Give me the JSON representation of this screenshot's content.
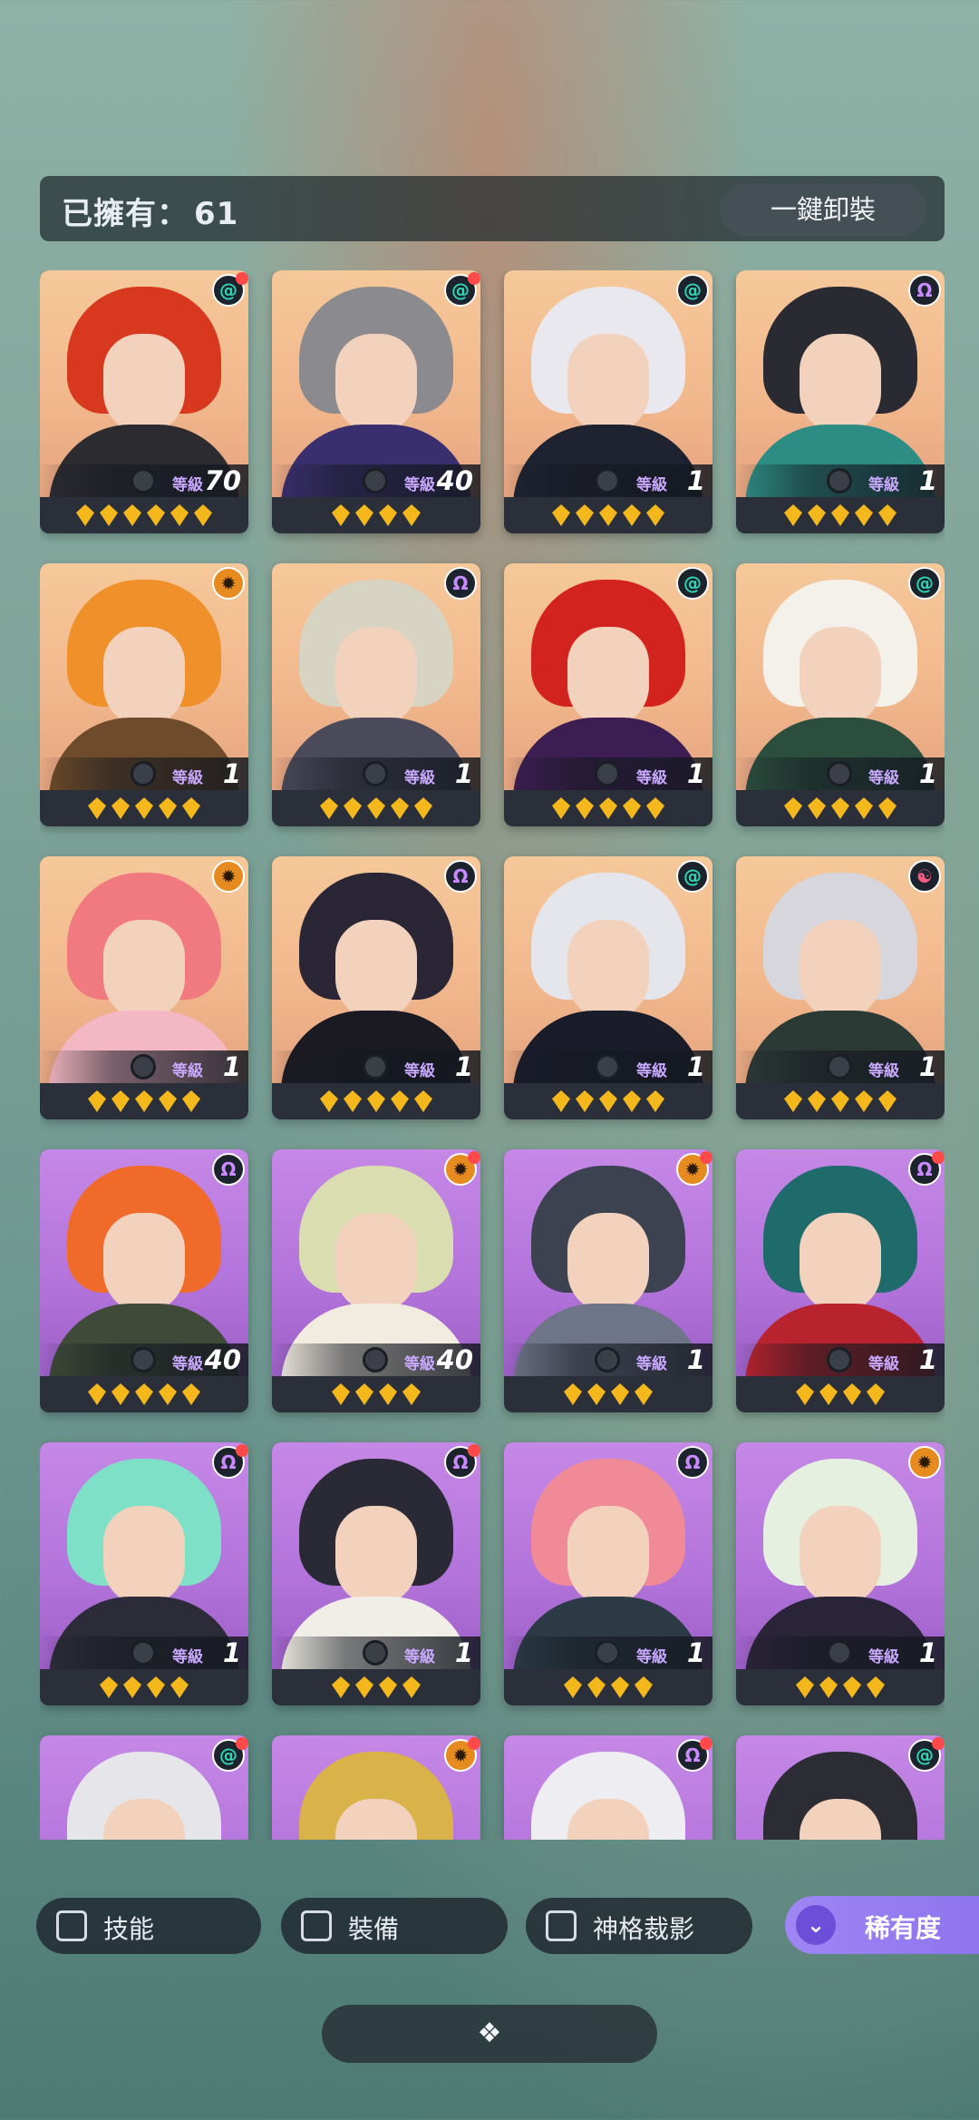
{
  "header": {
    "owned_label": "已擁有：",
    "owned_count": "61",
    "unequip_label": "一鍵卸裝"
  },
  "level_label": "等級",
  "cards": [
    {
      "element": "swirl",
      "dot": true,
      "level": "70",
      "stars": 6,
      "bg": "peach",
      "hair": "#d8381e",
      "body": "#2b2b30"
    },
    {
      "element": "swirl",
      "dot": true,
      "level": "40",
      "stars": 4,
      "bg": "peach",
      "hair": "#8a8a8f",
      "body": "#3a2f6e"
    },
    {
      "element": "swirl",
      "dot": false,
      "level": "1",
      "stars": 5,
      "bg": "peach",
      "hair": "#e8e8ee",
      "body": "#1f2230"
    },
    {
      "element": "omega",
      "dot": false,
      "level": "1",
      "stars": 5,
      "bg": "peach",
      "hair": "#2a2a33",
      "body": "#2d8c84"
    },
    {
      "element": "sun",
      "dot": false,
      "level": "1",
      "stars": 5,
      "bg": "peach",
      "hair": "#f0902a",
      "body": "#6e4b2a"
    },
    {
      "element": "omega",
      "dot": false,
      "level": "1",
      "stars": 5,
      "bg": "peach",
      "hair": "#d7d4c4",
      "body": "#4a4a5a"
    },
    {
      "element": "swirl",
      "dot": false,
      "level": "1",
      "stars": 5,
      "bg": "peach",
      "hair": "#d2231f",
      "body": "#3d1e52"
    },
    {
      "element": "swirl",
      "dot": false,
      "level": "1",
      "stars": 5,
      "bg": "peach",
      "hair": "#f4f0ea",
      "body": "#2b4e3e"
    },
    {
      "element": "sun",
      "dot": false,
      "level": "1",
      "stars": 5,
      "bg": "peach",
      "hair": "#f07a80",
      "body": "#f4b7c4"
    },
    {
      "element": "omega",
      "dot": false,
      "level": "1",
      "stars": 5,
      "bg": "peach",
      "hair": "#2a2635",
      "body": "#1b1a22"
    },
    {
      "element": "swirl",
      "dot": false,
      "level": "1",
      "stars": 5,
      "bg": "peach",
      "hair": "#e5e5ec",
      "body": "#1a1c2a"
    },
    {
      "element": "yinyang",
      "dot": false,
      "level": "1",
      "stars": 5,
      "bg": "peach",
      "hair": "#d6d6dc",
      "body": "#2c3a36"
    },
    {
      "element": "omega",
      "dot": false,
      "level": "40",
      "stars": 5,
      "bg": "purple",
      "hair": "#f06a2a",
      "body": "#3f4a38"
    },
    {
      "element": "sun",
      "dot": true,
      "level": "40",
      "stars": 4,
      "bg": "purple",
      "hair": "#d9ddb0",
      "body": "#f1ebe0"
    },
    {
      "element": "sun",
      "dot": true,
      "level": "1",
      "stars": 4,
      "bg": "purple",
      "hair": "#3c4250",
      "body": "#6f7588"
    },
    {
      "element": "omega",
      "dot": true,
      "level": "1",
      "stars": 4,
      "bg": "purple",
      "hair": "#1f6b6b",
      "body": "#b8232e"
    },
    {
      "element": "omega",
      "dot": true,
      "level": "1",
      "stars": 4,
      "bg": "purple",
      "hair": "#7fe0c8",
      "body": "#2c2c38"
    },
    {
      "element": "omega",
      "dot": true,
      "level": "1",
      "stars": 4,
      "bg": "purple",
      "hair": "#2a2a36",
      "body": "#f0eee6"
    },
    {
      "element": "omega",
      "dot": false,
      "level": "1",
      "stars": 4,
      "bg": "purple",
      "hair": "#f08a96",
      "body": "#2b3a44"
    },
    {
      "element": "sun",
      "dot": false,
      "level": "1",
      "stars": 4,
      "bg": "purple",
      "hair": "#e6f0e0",
      "body": "#2a2438"
    },
    {
      "element": "swirl",
      "dot": true,
      "level": "",
      "stars": 0,
      "bg": "purple",
      "hair": "#e6e6ea",
      "body": "#22263a"
    },
    {
      "element": "sun",
      "dot": true,
      "level": "",
      "stars": 0,
      "bg": "purple",
      "hair": "#d9b24a",
      "body": "#5a4a2a"
    },
    {
      "element": "omega",
      "dot": true,
      "level": "",
      "stars": 0,
      "bg": "purple",
      "hair": "#eeeef2",
      "body": "#dcdce4"
    },
    {
      "element": "swirl",
      "dot": true,
      "level": "",
      "stars": 0,
      "bg": "purple",
      "hair": "#2c2c34",
      "body": "#3a3a44"
    }
  ],
  "filters": [
    {
      "label": "技能"
    },
    {
      "label": "裝備"
    },
    {
      "label": "神格裁影"
    }
  ],
  "rarity": {
    "label": "稀有度"
  }
}
